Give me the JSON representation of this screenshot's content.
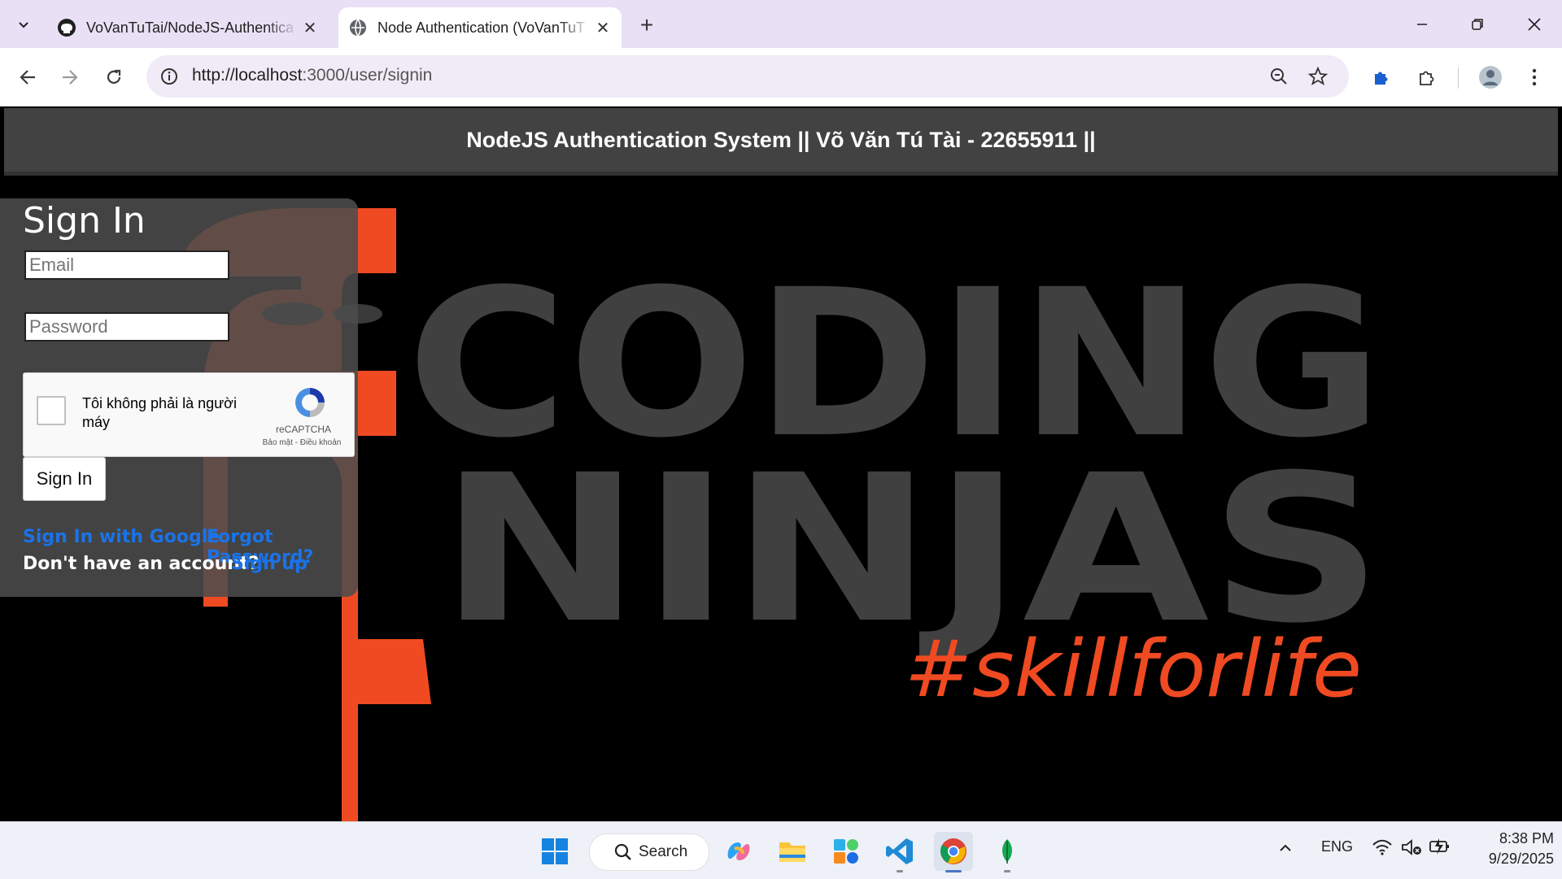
{
  "browser": {
    "tabs": [
      {
        "title": "VoVanTuTai/NodeJS-Authentica",
        "icon": "github-icon",
        "active": false
      },
      {
        "title": "Node Authentication (VoVanTuT",
        "icon": "globe-icon",
        "active": true
      }
    ],
    "new_tab_label": "+",
    "address": {
      "host": "http://localhost",
      "rest": ":3000/user/signin"
    }
  },
  "page": {
    "header_title": "NodeJS Authentication System || Võ Văn Tú Tài - 22655911 ||",
    "background": {
      "line1": "CODING",
      "line2": "NINJAS",
      "tagline": "#skillforlife",
      "accent_color": "#f04a22",
      "letter_color": "#404040"
    },
    "signin": {
      "heading": "Sign In",
      "email_placeholder": "Email",
      "password_placeholder": "Password",
      "recaptcha": {
        "label": "Tôi không phải là người máy",
        "brand": "reCAPTCHA",
        "terms": "Bảo mật - Điều khoản"
      },
      "button": "Sign In",
      "google_link": "Sign In with Google",
      "forgot_link": "Forgot Password?",
      "no_account_text": "Don't have an account?",
      "signup_link": "Sign up"
    }
  },
  "taskbar": {
    "search_label": "Search",
    "language": "ENG",
    "time": "8:38 PM",
    "date": "9/29/2025"
  }
}
